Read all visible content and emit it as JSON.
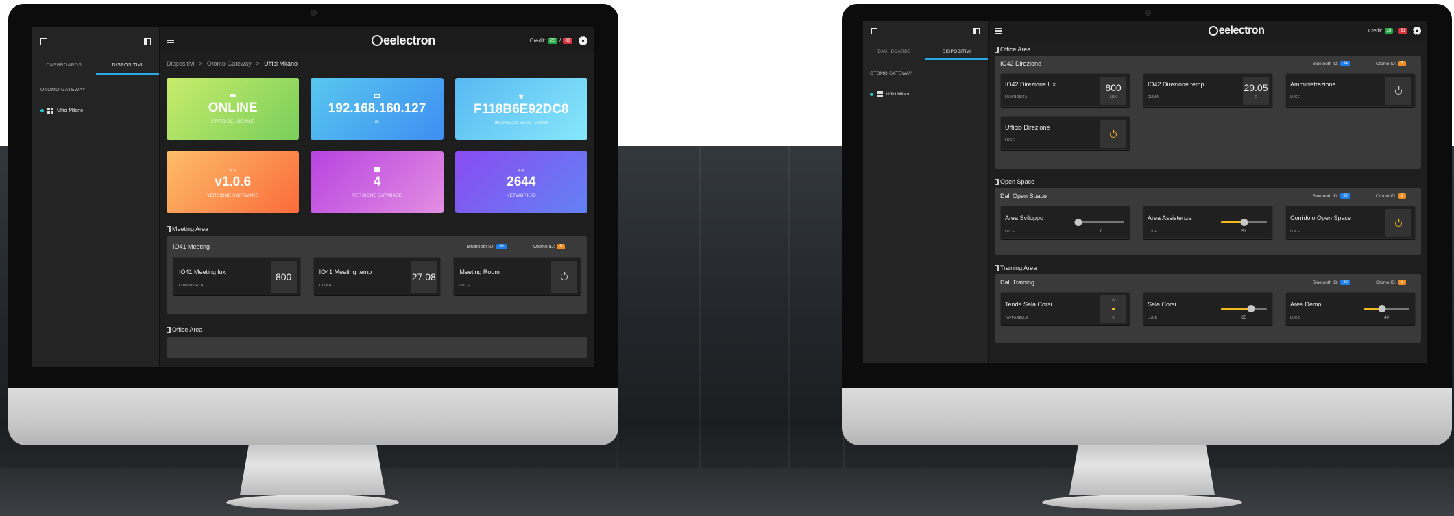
{
  "app": {
    "brand": "eelectron",
    "credit_label": "Credit:",
    "credit_separator": "/",
    "credit_green": "28",
    "credit_red": "81"
  },
  "icons": {
    "logout": "exit-icon",
    "map": "map-icon",
    "menu": "hamburger-icon",
    "settings": "gear-icon",
    "device": "grid-icon",
    "area": "door-icon",
    "power": "power-icon",
    "status": "toggle-icon",
    "ip": "network-icon",
    "bluetooth": "bluetooth-icon",
    "software": "code-icon",
    "database": "database-icon",
    "network": "code-arrows-icon"
  },
  "colors": {
    "accent": "#29a9e8",
    "bluetooth_badge": "#1f7ee8",
    "otomo_badge": "#f08c24",
    "power_on": "#f3b81d",
    "credit_green": "#27a844",
    "credit_red": "#d9323f"
  },
  "sidebar": {
    "tabs": [
      "DASHBOARDS",
      "DISPOSITIVI"
    ],
    "active_tab": "DISPOSITIVI",
    "section": "OTOMO GATEWAY",
    "item": "Uffici Milano"
  },
  "left": {
    "breadcrumb": [
      "Dispositivi",
      ">",
      "Otomo Gateway",
      ">",
      "Uffici Milano"
    ],
    "cards": [
      {
        "value": "ONLINE",
        "label": "STATO DEL DEVICE"
      },
      {
        "value": "192.168.160.127",
        "label": "IP"
      },
      {
        "value": "F118B6E92DC8",
        "label": "INDIRIZZO BLUETOOTH"
      },
      {
        "value": "v1.0.6",
        "label": "VERSIONE SOFTWARE"
      },
      {
        "value": "4",
        "label": "VERSIONE DATABASE"
      },
      {
        "value": "2644",
        "label": "NETWORK ID"
      }
    ],
    "meeting": {
      "area": "Meeting Area",
      "device": "IO41 Meeting",
      "bt_label": "Bluetooth ID:",
      "bt_id": "36",
      "otomo_label": "Otomo ID:",
      "otomo_id": "5",
      "tiles": [
        {
          "name": "IO41 Meeting lux",
          "sub": "LUMINOSITÀ",
          "value": "800"
        },
        {
          "name": "IO41 Meeting temp",
          "sub": "CLIMA",
          "value": "27.08"
        },
        {
          "name": "Meeting Room",
          "sub": "LUCE"
        }
      ]
    },
    "office_area": "Office Area"
  },
  "right": {
    "office": {
      "area": "Office Area",
      "device": "IO42 Direzione",
      "bt_label": "Bluetooth ID:",
      "bt_id": "34",
      "otomo_label": "Otomo ID:",
      "otomo_id": "5",
      "tiles": [
        {
          "name": "IO42 Direzione lux",
          "sub": "LUMINOSITÀ",
          "value": "800",
          "unit": "LUX"
        },
        {
          "name": "IO42 Direzione temp",
          "sub": "CLIMA",
          "value": "29.05",
          "unit": "C"
        },
        {
          "name": "Amministrazione",
          "sub": "LUCE"
        },
        {
          "name": "Ufficio Direzione",
          "sub": "LUCE"
        }
      ]
    },
    "open_space": {
      "area": "Open Space",
      "device": "Dali Open Space",
      "bt_label": "Bluetooth ID:",
      "bt_id": "32",
      "otomo_label": "Otomo ID:",
      "otomo_id": "2",
      "tiles": [
        {
          "name": "Area Sviluppo",
          "sub": "LUCE",
          "value": "0",
          "level": 0
        },
        {
          "name": "Area Assistenza",
          "sub": "LUCE",
          "value": "51",
          "level": 51
        },
        {
          "name": "Corridoio Open Space",
          "sub": "LUCE"
        }
      ]
    },
    "training": {
      "area": "Training Area",
      "device": "Dali Training",
      "bt_label": "Bluetooth ID:",
      "bt_id": "32",
      "otomo_label": "Otomo ID:",
      "otomo_id": "2",
      "tiles": [
        {
          "name": "Tende Sala Corsi",
          "sub": "TAPPARELLE"
        },
        {
          "name": "Sala Corsi",
          "sub": "LUCE",
          "value": "65",
          "level": 65
        },
        {
          "name": "Area Demo",
          "sub": "LUCE",
          "value": "40",
          "level": 40
        }
      ]
    }
  }
}
